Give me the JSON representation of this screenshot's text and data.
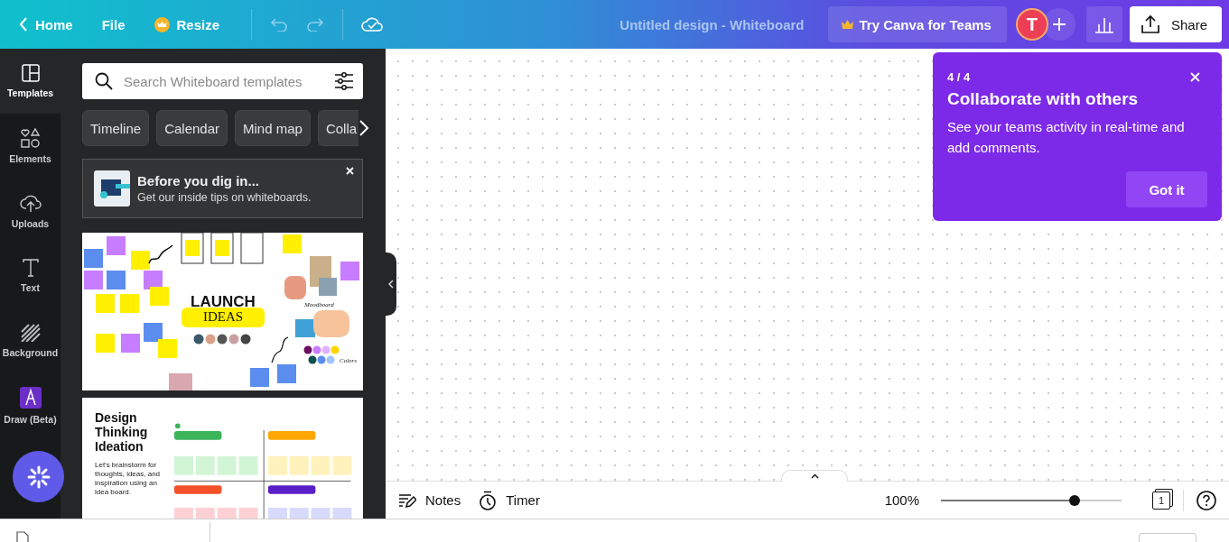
{
  "topbar": {
    "back_label": "Home",
    "menu": [
      "File"
    ],
    "resize": "Resize",
    "title": "Untitled design - Whiteboard",
    "teams_button": "Try Canva for Teams",
    "avatar": "T",
    "share": "Share"
  },
  "rail": [
    {
      "label": "Templates",
      "kind": "templates",
      "selected": true
    },
    {
      "label": "Elements",
      "kind": "elements",
      "selected": false
    },
    {
      "label": "Uploads",
      "kind": "uploads",
      "selected": false
    },
    {
      "label": "Text",
      "kind": "text",
      "selected": false
    },
    {
      "label": "Background",
      "kind": "background",
      "selected": false
    },
    {
      "label": "Draw (Beta)",
      "kind": "draw",
      "selected": false
    }
  ],
  "panel": {
    "search": {
      "placeholder": "Search Whiteboard templates"
    },
    "chips": [
      "Timeline",
      "Calendar",
      "Mind map",
      "Colla"
    ],
    "tip": {
      "title": "Before you dig in...",
      "text": "Get our inside tips on whiteboards."
    },
    "templates": [
      {
        "kind": "moodboard",
        "title_lines": [
          "LAUNCH",
          "IDEAS"
        ],
        "moodboard_label": "Moodboard",
        "colors_label": "Colors"
      },
      {
        "kind": "ideation",
        "title_lines": [
          "Design",
          "Thinking",
          "Ideation"
        ],
        "text": "Let's brainstorm for thoughts, ideas, and inspiration using an idea board."
      }
    ]
  },
  "tooltip": {
    "step": "4 / 4",
    "title": "Collaborate with others",
    "text": "See your teams activity in real-time and add comments.",
    "button": "Got it"
  },
  "bottombar": {
    "notes": "Notes",
    "timer": "Timer",
    "zoom": "100%",
    "level": 0.74,
    "page": "1"
  }
}
